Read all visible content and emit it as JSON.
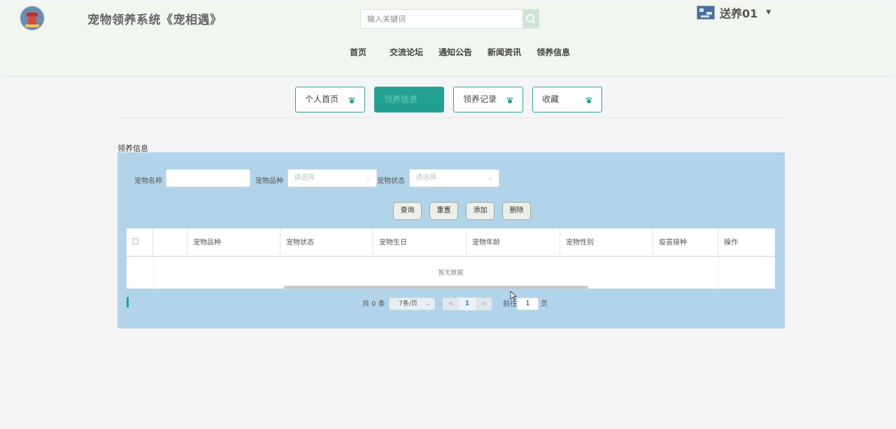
{
  "header": {
    "site_title": "宠物领养系统《宠相遇》",
    "search_placeholder": "输入关键词",
    "username": "送养01",
    "nav": [
      "首页",
      "交流论坛",
      "通知公告",
      "新闻资讯",
      "领养信息"
    ]
  },
  "tabs": [
    {
      "label": "个人首页",
      "active": false
    },
    {
      "label": "领养信息",
      "active": true
    },
    {
      "label": "领养记录",
      "active": false
    },
    {
      "label": "收藏",
      "active": false
    }
  ],
  "section_title": "领养信息",
  "filters": {
    "name_label": "宠物名称",
    "name_value": "",
    "breed_label": "宠物品种",
    "breed_placeholder": "请选择",
    "status_label": "宠物状态",
    "status_placeholder": "请选择"
  },
  "actions": {
    "query": "查询",
    "reset": "重置",
    "add": "添加",
    "delete": "删除"
  },
  "table": {
    "columns": [
      "",
      "宠物品种",
      "宠物状态",
      "宠物生日",
      "宠物年龄",
      "宠物性别",
      "疫苗接种",
      "操作"
    ],
    "empty_text": "暂无数据"
  },
  "pagination": {
    "total_text": "共 0 条",
    "page_size": "7条/页",
    "current_page": "1",
    "goto_label": "前往",
    "goto_value": "1",
    "page_suffix": "页",
    "prev_glyph": "<",
    "next_glyph": ">"
  },
  "colors": {
    "accent": "#22a192",
    "panel": "#b2d4ea",
    "header_bg": "#f1f6ee"
  }
}
